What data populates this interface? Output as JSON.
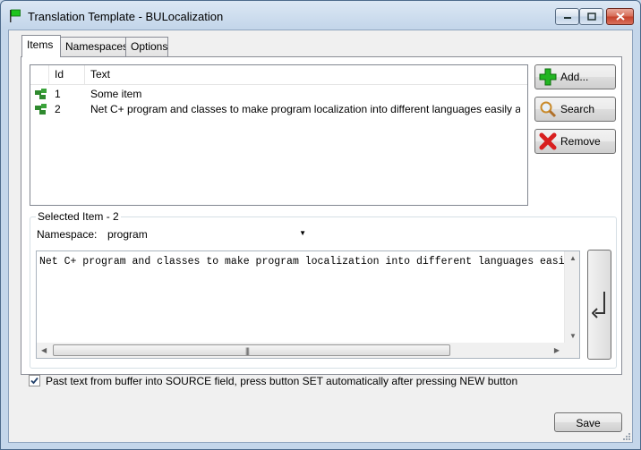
{
  "window": {
    "title": "Translation Template - BULocalization"
  },
  "tabs": [
    {
      "label": "Items",
      "active": true
    },
    {
      "label": "Namespaces",
      "active": false
    },
    {
      "label": "Options",
      "active": false
    }
  ],
  "items_list": {
    "columns": [
      "",
      "Id",
      "Text"
    ],
    "rows": [
      {
        "icon": "tree-node-icon",
        "id": "1",
        "text": "Some item"
      },
      {
        "icon": "tree-node-icon",
        "id": "2",
        "text": "Net C+ program and classes to make program localization into different languages easily and with c..."
      }
    ]
  },
  "side_buttons": {
    "add": "Add...",
    "search": "Search",
    "remove": "Remove"
  },
  "selected_item": {
    "title": "Selected Item - 2",
    "namespace_label": "Namespace:",
    "namespace_value": "program",
    "text": "Net C+ program and classes to make program localization into different languages easily"
  },
  "options": {
    "paste_checkbox_label": "Past text from buffer into SOURCE field, press button SET automatically after pressing NEW button",
    "paste_checked": true
  },
  "footer": {
    "save_label": "Save"
  },
  "colors": {
    "accent_green": "#1f9e1f",
    "remove_red": "#d81f1f"
  }
}
